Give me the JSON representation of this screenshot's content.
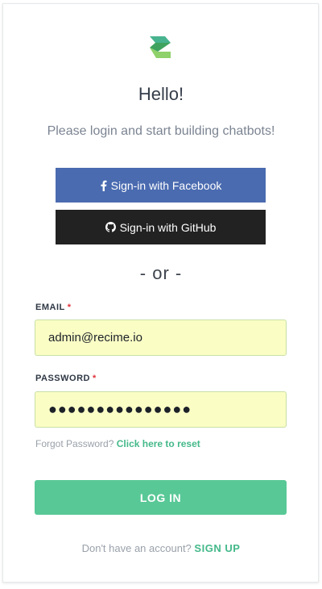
{
  "brand": {
    "logo_icon": "recime-logo-icon",
    "colors": {
      "green_dark": "#3fa35f",
      "green_light": "#8fd16a",
      "teal": "#47b38f"
    }
  },
  "header": {
    "title": "Hello!",
    "subtitle": "Please login and start building chatbots!"
  },
  "social": {
    "facebook": {
      "label": "Sign-in with Facebook",
      "icon": "facebook-icon",
      "color": "#4a6bb0"
    },
    "github": {
      "label": "Sign-in with GitHub",
      "icon": "github-icon",
      "color": "#222222"
    }
  },
  "divider": {
    "text": "- or -"
  },
  "form": {
    "email": {
      "label": "EMAIL",
      "required_mark": "*",
      "value": "admin@recime.io"
    },
    "password": {
      "label": "PASSWORD",
      "required_mark": "*",
      "value": "●●●●●●●●●●●●●●●"
    },
    "forgot": {
      "text": "Forgot Password?",
      "link": "Click here to reset"
    },
    "submit_label": "LOG IN"
  },
  "footer": {
    "text": "Don't have an account?",
    "link": "SIGN UP"
  },
  "colors": {
    "input_bg": "#fafec5",
    "accent_green": "#58c896",
    "link_green": "#44b98a",
    "required_red": "#e0313a"
  }
}
